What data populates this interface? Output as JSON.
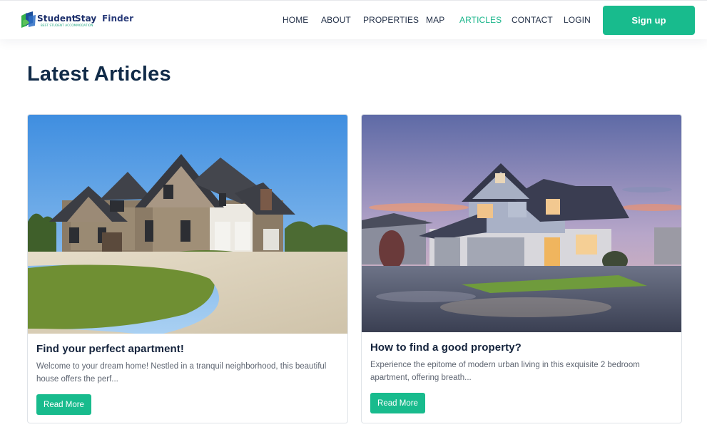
{
  "brand": {
    "word_1": "Student",
    "word_2": "Stay",
    "word_3": "Finder",
    "tagline": "BEST STUDENT ACCOMMODATION",
    "logo_colors": {
      "blue": "#1d4f9b",
      "green": "#37b24a"
    }
  },
  "nav": {
    "items": [
      {
        "label": "HOME",
        "active": false
      },
      {
        "label": "ABOUT",
        "active": false
      },
      {
        "label": "PROPERTIES",
        "active": false
      },
      {
        "label": "MAP",
        "active": false
      },
      {
        "label": "ARTICLES",
        "active": true
      },
      {
        "label": "CONTACT",
        "active": false
      },
      {
        "label": "LOGIN",
        "active": false
      }
    ],
    "signup_label": "Sign up"
  },
  "page": {
    "title": "Latest Articles"
  },
  "articles": [
    {
      "title": "Find your perfect apartment!",
      "excerpt": "Welcome to your dream home! Nestled in a tranquil neighborhood, this beautiful house offers the perf...",
      "button_label": "Read More",
      "image": "suburban-stone-house-photo"
    },
    {
      "title": "How to find a good property?",
      "excerpt": "Experience the epitome of modern urban living in this exquisite 2 bedroom apartment, offering breath...",
      "button_label": "Read More",
      "image": "modern-house-at-dusk-photo"
    }
  ],
  "colors": {
    "accent": "#18bb8d",
    "heading": "#112b48",
    "nav_text": "#233048",
    "body_text": "#5f6672"
  }
}
